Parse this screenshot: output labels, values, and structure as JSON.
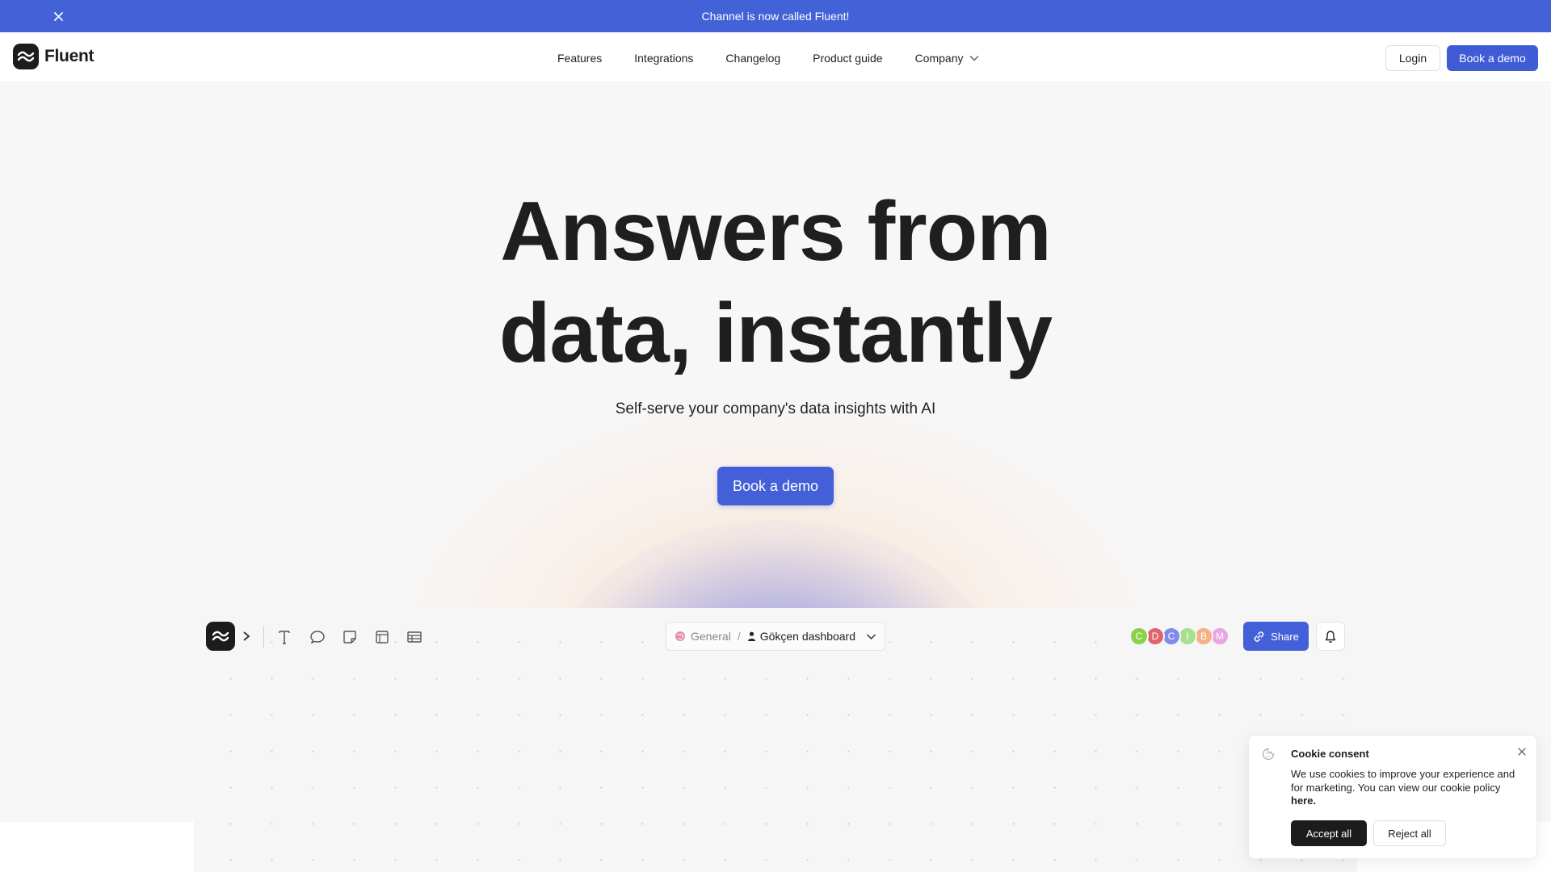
{
  "banner": {
    "text": "Channel is now called Fluent!",
    "close_icon": "close-icon"
  },
  "header": {
    "logo_text": "Fluent",
    "nav": [
      "Features",
      "Integrations",
      "Changelog",
      "Product guide",
      "Company"
    ],
    "login_label": "Login",
    "demo_label": "Book a demo"
  },
  "hero": {
    "headline_line1": "Answers from",
    "headline_line2": "data, instantly",
    "subheadline": "Self-serve your company's data insights with AI",
    "cta_label": "Book a demo"
  },
  "app_preview": {
    "tools": [
      "text-tool-icon",
      "comment-icon",
      "sticky-note-icon",
      "frame-icon",
      "table-icon"
    ],
    "breadcrumb_space": "General",
    "breadcrumb_separator": "/",
    "breadcrumb_dashboard": "Gökçen dashboard",
    "avatars": [
      {
        "initial": "C",
        "color": "#8bd14a"
      },
      {
        "initial": "D",
        "color": "#e0656a"
      },
      {
        "initial": "C",
        "color": "#7f8be8"
      },
      {
        "initial": "I",
        "color": "#a8e08f"
      },
      {
        "initial": "B",
        "color": "#f3b184"
      },
      {
        "initial": "M",
        "color": "#e8a6e2"
      }
    ],
    "share_label": "Share"
  },
  "cookie": {
    "title": "Cookie consent",
    "body": "We use cookies to improve your experience and for marketing. You can view our cookie policy ",
    "link_label": "here.",
    "accept_label": "Accept all",
    "reject_label": "Reject all"
  },
  "colors": {
    "accent": "#4362d8",
    "dark": "#1c1c1c"
  }
}
